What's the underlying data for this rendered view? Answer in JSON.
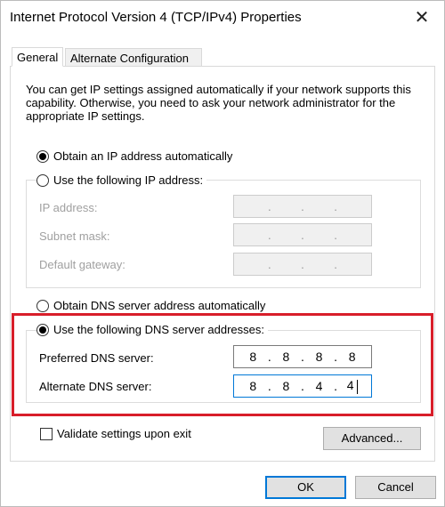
{
  "window": {
    "title": "Internet Protocol Version 4 (TCP/IPv4) Properties",
    "close_icon": "close-icon"
  },
  "tabs": [
    {
      "label": "General",
      "active": true
    },
    {
      "label": "Alternate Configuration",
      "active": false
    }
  ],
  "info_text": "You can get IP settings assigned automatically if your network supports this capability. Otherwise, you need to ask your network administrator for the appropriate IP settings.",
  "ip_settings": {
    "auto_label": "Obtain an IP address automatically",
    "auto_selected": true,
    "manual_label": "Use the following IP address:",
    "manual_selected": false,
    "fields": [
      {
        "label": "IP address:",
        "value": [
          "",
          "",
          "",
          ""
        ],
        "enabled": false
      },
      {
        "label": "Subnet mask:",
        "value": [
          "",
          "",
          "",
          ""
        ],
        "enabled": false
      },
      {
        "label": "Default gateway:",
        "value": [
          "",
          "",
          "",
          ""
        ],
        "enabled": false
      }
    ]
  },
  "dns_settings": {
    "auto_label": "Obtain DNS server address automatically",
    "auto_selected": false,
    "manual_label": "Use the following DNS server addresses:",
    "manual_selected": true,
    "preferred": {
      "label": "Preferred DNS server:",
      "octets": [
        "8",
        "8",
        "8",
        "8"
      ]
    },
    "alternate": {
      "label": "Alternate DNS server:",
      "octets": [
        "8",
        "8",
        "4",
        "4"
      ]
    }
  },
  "validate": {
    "label": "Validate settings upon exit",
    "checked": false
  },
  "buttons": {
    "advanced": "Advanced...",
    "ok": "OK",
    "cancel": "Cancel"
  },
  "colors": {
    "highlight": "#d81e2a",
    "default_button_border": "#0078d7"
  }
}
